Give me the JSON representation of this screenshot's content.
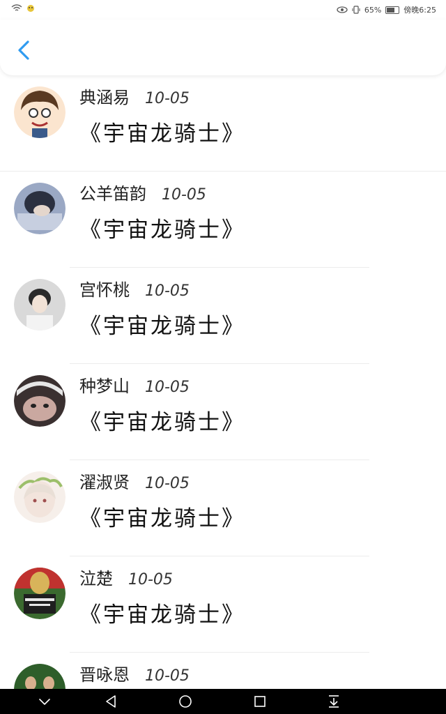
{
  "status_bar": {
    "battery": "65%",
    "time": "傍晚6:25"
  },
  "list": [
    {
      "name": "典涵易",
      "date": "10-05",
      "title": "《宇宙龙骑士》"
    },
    {
      "name": "公羊笛韵",
      "date": "10-05",
      "title": "《宇宙龙骑士》"
    },
    {
      "name": "宫怀桃",
      "date": "10-05",
      "title": "《宇宙龙骑士》"
    },
    {
      "name": "种梦山",
      "date": "10-05",
      "title": "《宇宙龙骑士》"
    },
    {
      "name": "濯淑贤",
      "date": "10-05",
      "title": "《宇宙龙骑士》"
    },
    {
      "name": "泣楚",
      "date": "10-05",
      "title": "《宇宙龙骑士》"
    },
    {
      "name": "晋咏恩",
      "date": "10-05",
      "title": ""
    }
  ],
  "icons": {
    "back": "chevron-left-icon",
    "nav": [
      "chevron-down-icon",
      "back-triangle-icon",
      "home-circle-icon",
      "recents-square-icon",
      "download-icon"
    ]
  },
  "colors": {
    "accent": "#2f9bf0",
    "navbar": "#000000"
  }
}
